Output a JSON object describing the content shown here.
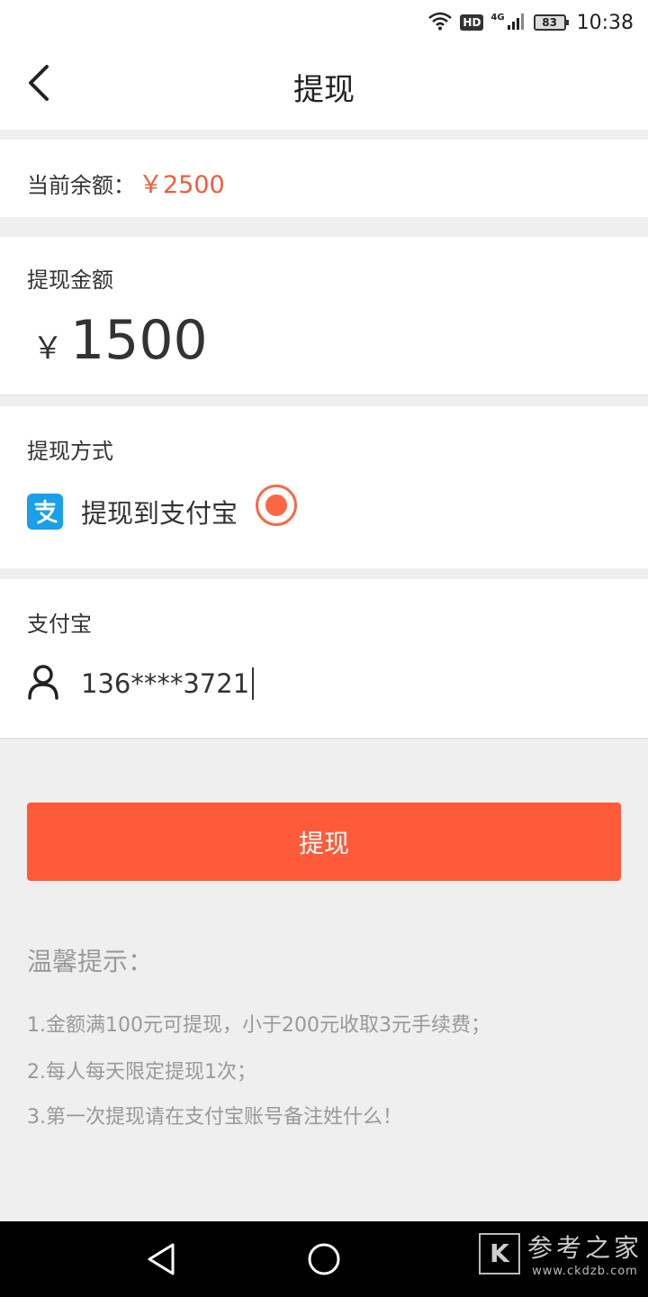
{
  "status_bar": {
    "hd_badge": "HD",
    "network_type": "4G",
    "battery_level": "83",
    "time": "10:38"
  },
  "header": {
    "title": "提现",
    "back_icon": "chevron-left-icon"
  },
  "balance": {
    "label": "当前余额：",
    "value": "￥2500"
  },
  "amount": {
    "label": "提现金额",
    "currency": "￥",
    "value": "1500"
  },
  "method": {
    "label": "提现方式",
    "option_label": "提现到支付宝",
    "option_icon": "alipay-icon",
    "selected": true
  },
  "account": {
    "label": "支付宝",
    "icon": "user-icon",
    "value": "136****3721"
  },
  "submit": {
    "label": "提现"
  },
  "tips": {
    "title": "温馨提示：",
    "items": [
      "1.金额满100元可提现，小于200元收取3元手续费；",
      "2.每人每天限定提现1次；",
      "3.第一次提现请在支付宝账号备注姓什么！"
    ]
  },
  "system_nav": {
    "buttons": [
      "back-triangle-icon",
      "home-circle-icon"
    ]
  },
  "watermark": {
    "logo_letter": "K",
    "name": "参考之家",
    "url": "www.ckdzb.com"
  },
  "colors": {
    "accent": "#ff5a3a",
    "balance_text": "#f25c3b",
    "radio": "#f96845",
    "alipay_blue": "#1a9fe8",
    "background": "#efefef"
  }
}
